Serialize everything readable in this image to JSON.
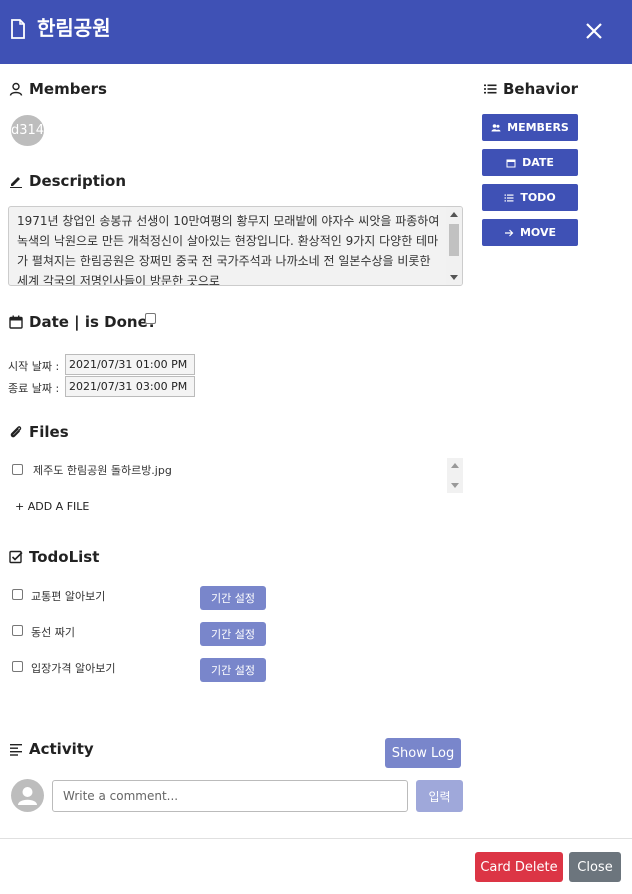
{
  "header": {
    "title": "한림공원",
    "icons": {
      "doc": "document-icon",
      "close": "close-icon"
    }
  },
  "members": {
    "title": "Members",
    "icon": "person-icon",
    "chip_text": "d314"
  },
  "description": {
    "title": "Description",
    "icon": "pencil-icon",
    "text": " 1971년 창업인 송봉규 선생이 10만여평의 황무지 모래밭에 야자수 씨앗을 파종하여 녹색의 낙원으로 만든 개척정신이 살아있는 현장입니다. 환상적인 9가지 다양한 테마가 펼쳐지는 한림공원은 장쩌민 중국 전 국가주석과 나까소네 전 일본수상을 비롯한 세계 각국의 저명인사들이 방문한 곳으로"
  },
  "date": {
    "title": "Date | is Done?",
    "icon": "calendar-icon",
    "start_label": "시작 날짜 :",
    "start_value": "2021/07/31 01:00 PM",
    "end_label": "종료 날짜 :",
    "end_value": "2021/07/31 03:00 PM"
  },
  "files": {
    "title": "Files",
    "icon": "paperclip-icon",
    "items": [
      {
        "name": "제주도 한림공원 돌하르방.jpg"
      }
    ],
    "add_label": "+ ADD A FILE"
  },
  "todolist": {
    "title": "TodoList",
    "icon": "checkbox-icon",
    "items": [
      {
        "label": "교통편 알아보기",
        "button": "기간 설정"
      },
      {
        "label": "동선 짜기",
        "button": "기간 설정"
      },
      {
        "label": "입장가격 알아보기",
        "button": "기간 설정"
      }
    ]
  },
  "activity": {
    "title": "Activity",
    "icon": "lines-icon",
    "show_log": "Show Log",
    "comment_placeholder": "Write a comment...",
    "submit": "입력"
  },
  "behavior": {
    "title": "Behavior",
    "icon": "list-icon",
    "buttons": [
      {
        "label": "MEMBERS",
        "icon": "group-icon"
      },
      {
        "label": "DATE",
        "icon": "calendar-icon"
      },
      {
        "label": "TODO",
        "icon": "list-icon"
      },
      {
        "label": "MOVE",
        "icon": "arrow-right-icon"
      }
    ]
  },
  "footer": {
    "delete_label": "Card Delete",
    "close_label": "Close"
  },
  "colors": {
    "primary": "#3f51b5",
    "primary_light": "#7986cb",
    "danger": "#dc3545",
    "secondary": "#6c757d"
  }
}
